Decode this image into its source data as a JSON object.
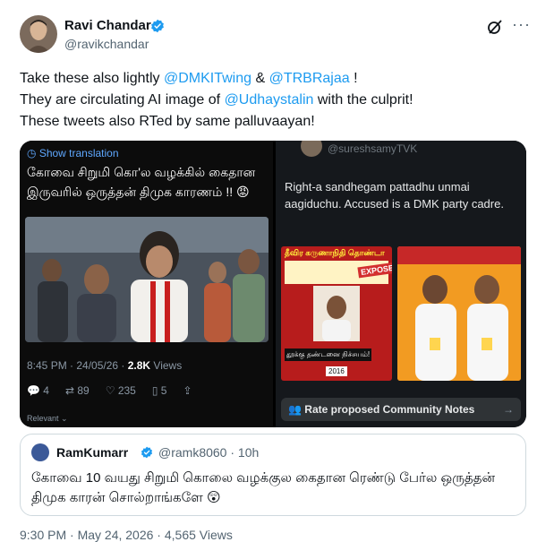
{
  "author": {
    "name": "Ravi Chandar",
    "handle": "@ravikchandar"
  },
  "icons": {
    "verified": "verified-badge-icon",
    "grok": "grok-icon",
    "more": "more-options-icon"
  },
  "tweet": {
    "line1_prefix": "Take these also lightly ",
    "mention1": "@DMKITwing",
    "line1_mid": " & ",
    "mention2": "@TRBRajaa",
    "line1_suffix": " !",
    "line2_prefix": "They are circulating AI image of ",
    "mention3": "@Udhaystalin",
    "line2_suffix": " with the culprit!",
    "line3": "These tweets also RTed by same palluvaayan!"
  },
  "media_left": {
    "show_translation": "Show translation",
    "tamil_text": "கோவை சிறுமி கொ'ல வழக்கில் கைதான இருவரில் ஒருத்தன் திமுக காரணம் !!",
    "timestamp": "8:45 PM · 24/05/26 · ",
    "views_count": "2.8K",
    "views_label": " Views",
    "replies": "4",
    "reposts": "89",
    "likes": "235",
    "bookmarks": "5",
    "relevant": "Relevant"
  },
  "media_right": {
    "handle": "@sureshsamyTVK",
    "text": "Right-a sandhegam pattadhu unmai aagiduchu. Accused is a DMK party cadre.",
    "poster_title": "தீவிர கருணாநிதி தொண்டா",
    "exposed": "EXPOSED",
    "poster_bottom": "தூக்கு தண்டனை நிச்சயம்!",
    "year": "2016",
    "community_notes": "Rate proposed Community Notes"
  },
  "quote": {
    "name": "RamKumarr",
    "handle": "@ramk8060 · 10h",
    "text": "கோவை 10 வயது சிறுமி கொலை வழக்குல கைதான ரெண்டு பேர்ல ஒருத்தன் திமுக காரன் சொல்றாங்களே"
  },
  "footer": {
    "text": "9:30 PM · May 24, 2026 · 4,565 Views"
  },
  "colors": {
    "accent": "#1d9bf0",
    "text": "#0f1419",
    "muted": "#536471"
  }
}
